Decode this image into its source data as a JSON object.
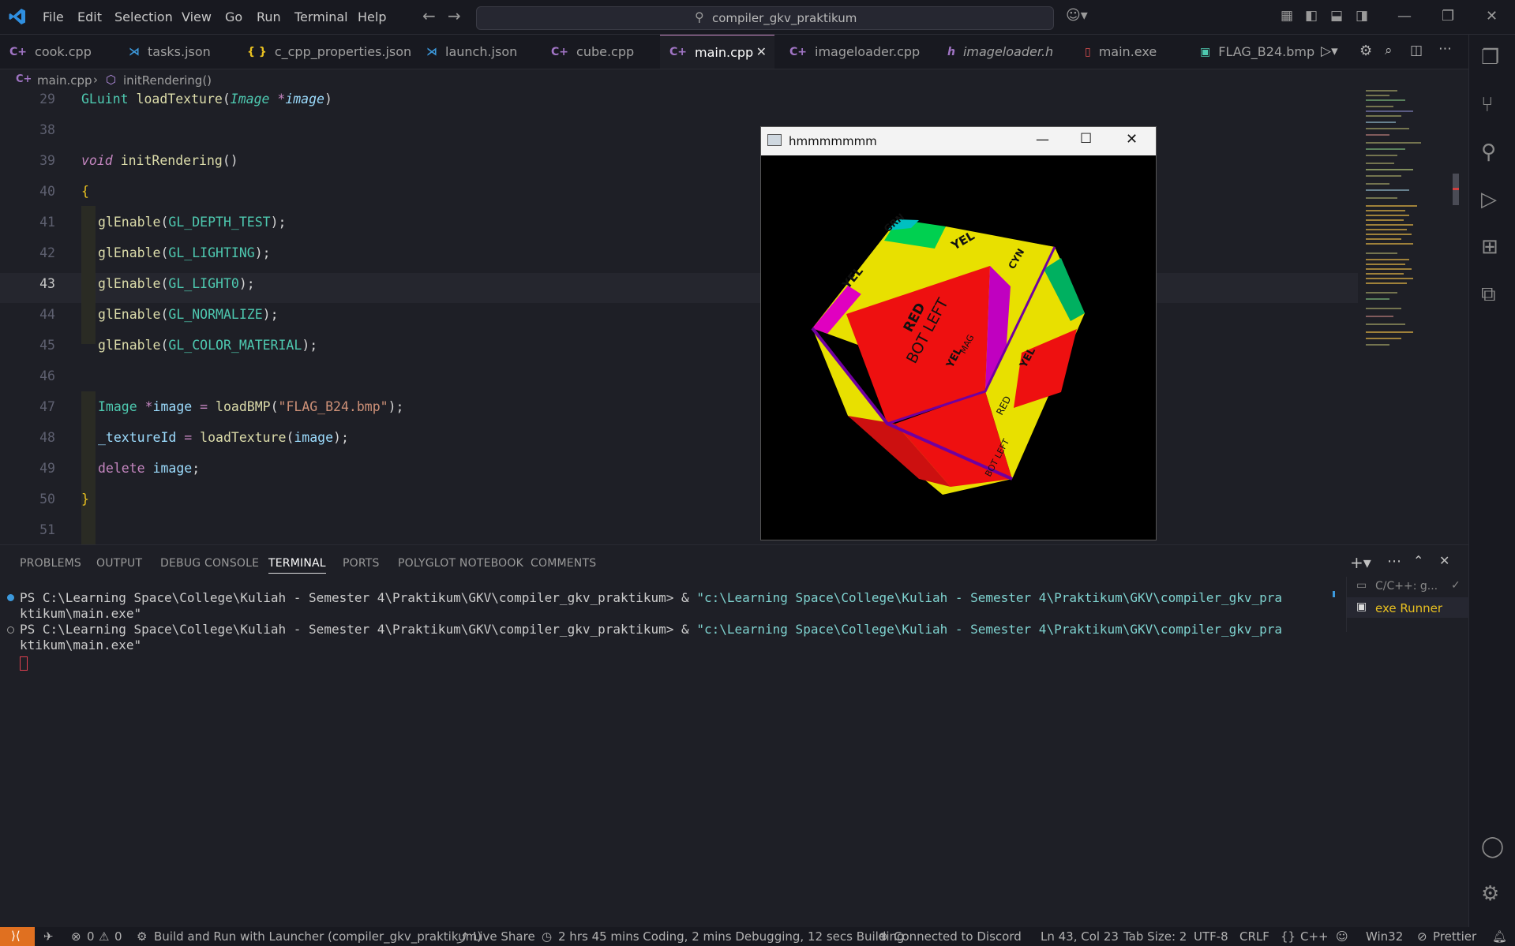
{
  "menu": [
    "File",
    "Edit",
    "Selection",
    "View",
    "Go",
    "Run",
    "Terminal",
    "Help"
  ],
  "search": {
    "text": "compiler_gkv_praktikum"
  },
  "tabs": [
    {
      "label": "cook.cpp",
      "icon": "C++",
      "color": "#a074c4"
    },
    {
      "label": "tasks.json",
      "icon": "VS",
      "color": "#3c99dc"
    },
    {
      "label": "c_cpp_properties.json",
      "icon": "{ }",
      "color": "#e8c020"
    },
    {
      "label": "launch.json",
      "icon": "VS",
      "color": "#3c99dc"
    },
    {
      "label": "cube.cpp",
      "icon": "C++",
      "color": "#a074c4"
    },
    {
      "label": "main.cpp",
      "icon": "C++",
      "color": "#a074c4",
      "active": true
    },
    {
      "label": "imageloader.cpp",
      "icon": "C++",
      "color": "#a074c4"
    },
    {
      "label": "imageloader.h",
      "icon": "h",
      "color": "#a074c4"
    },
    {
      "label": "main.exe",
      "icon": "exe",
      "color": "#e05050"
    },
    {
      "label": "FLAG_B24.bmp",
      "icon": "img",
      "color": "#4ec9b0"
    }
  ],
  "breadcrumb": {
    "file": "main.cpp",
    "symbol": "initRendering()"
  },
  "editor": {
    "lines": [
      {
        "n": "29",
        "code": "GLuint loadTexture(Image *image)"
      },
      {
        "n": "38",
        "code": ""
      },
      {
        "n": "39",
        "code": "void initRendering()"
      },
      {
        "n": "40",
        "code": "{"
      },
      {
        "n": "41",
        "code": "glEnable(GL_DEPTH_TEST);"
      },
      {
        "n": "42",
        "code": "glEnable(GL_LIGHTING);"
      },
      {
        "n": "43",
        "code": "glEnable(GL_LIGHT0);"
      },
      {
        "n": "44",
        "code": "glEnable(GL_NORMALIZE);"
      },
      {
        "n": "45",
        "code": "glEnable(GL_COLOR_MATERIAL);"
      },
      {
        "n": "46",
        "code": ""
      },
      {
        "n": "47",
        "code": "Image *image = loadBMP(\"FLAG_B24.bmp\");"
      },
      {
        "n": "48",
        "code": "_textureId = loadTexture(image);"
      },
      {
        "n": "49",
        "code": "delete image;"
      },
      {
        "n": "50",
        "code": "}"
      },
      {
        "n": "51",
        "code": ""
      }
    ]
  },
  "glwindow": {
    "title": "hmmmmmmm",
    "cube_labels": [
      "YEL",
      "RED",
      "BOT LEFT",
      "GRN",
      "CYN",
      "MAG"
    ]
  },
  "panel": {
    "tabs": [
      "PROBLEMS",
      "OUTPUT",
      "DEBUG CONSOLE",
      "TERMINAL",
      "PORTS",
      "POLYGLOT NOTEBOOK",
      "COMMENTS"
    ],
    "active_tab": "TERMINAL",
    "terminal_lines": [
      {
        "prompt": "PS C:\\Learning Space\\College\\Kuliah - Semester 4\\Praktikum\\GKV\\compiler_gkv_praktikum> & ",
        "cmd": "\"c:\\Learning Space\\College\\Kuliah - Semester 4\\Praktikum\\GKV\\compiler_gkv_pra",
        "cont": "ktikum\\main.exe\""
      },
      {
        "prompt": "PS C:\\Learning Space\\College\\Kuliah - Semester 4\\Praktikum\\GKV\\compiler_gkv_praktikum> & ",
        "cmd": "\"c:\\Learning Space\\College\\Kuliah - Semester 4\\Praktikum\\GKV\\compiler_gkv_pra",
        "cont": "ktikum\\main.exe\""
      }
    ],
    "terminal_list": [
      "C/C++: g...",
      "exe Runner"
    ]
  },
  "status": {
    "errors": "0",
    "warnings": "0",
    "launch": "Build and Run with Launcher (compiler_gkv_praktikum)",
    "liveshare": "Live Share",
    "time": "2 hrs 45 mins Coding, 2 mins Debugging, 12 secs Building",
    "discord": "Connected to Discord",
    "position": "Ln 43, Col 23",
    "tabsize": "Tab Size: 2",
    "encoding": "UTF-8",
    "eol": "CRLF",
    "language": "C++",
    "platform": "Win32",
    "prettier": "Prettier"
  }
}
